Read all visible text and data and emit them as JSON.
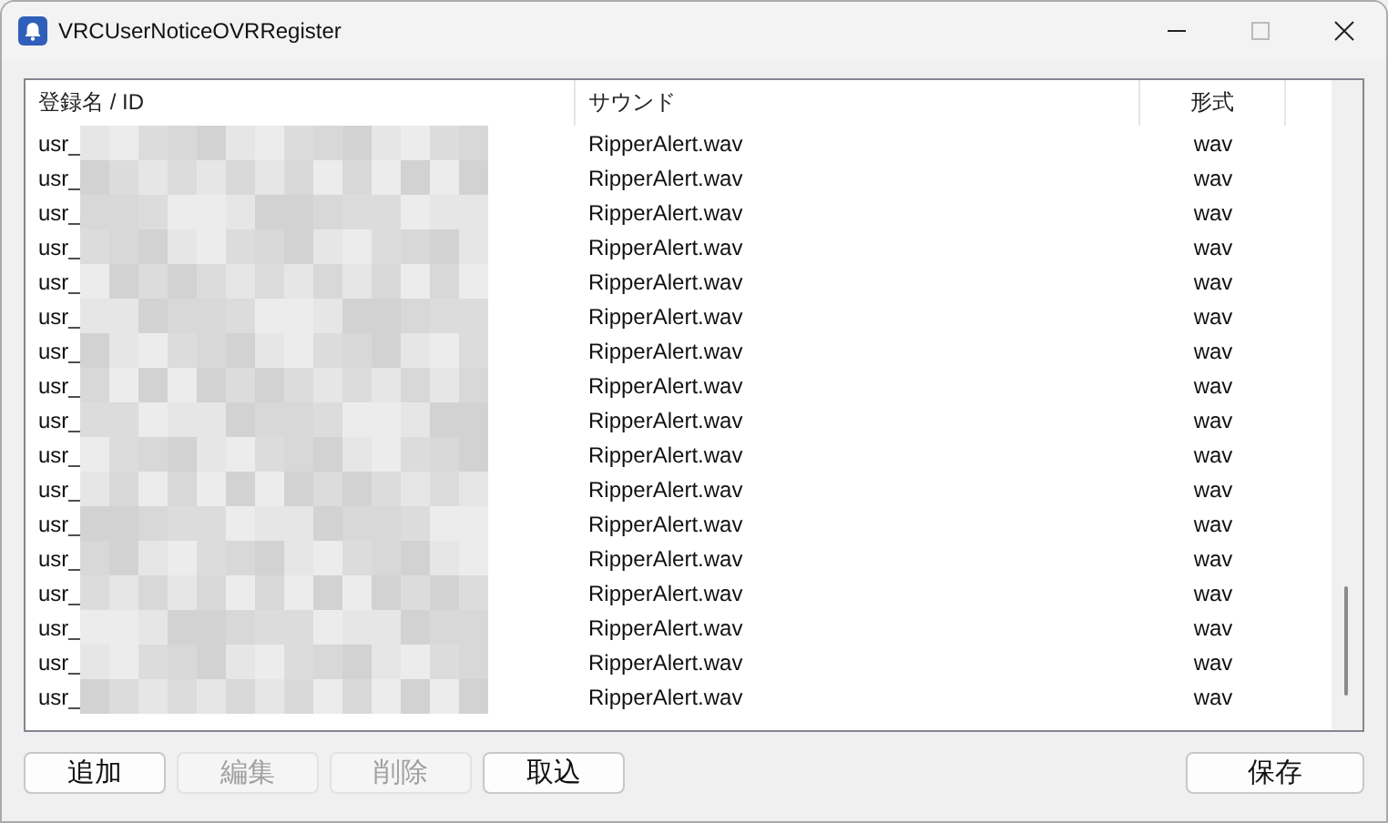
{
  "window": {
    "title": "VRCUserNoticeOVRRegister"
  },
  "table": {
    "columns": [
      "登録名 / ID",
      "サウンド",
      "形式"
    ],
    "rows": [
      {
        "name": "usr_",
        "sound": "RipperAlert.wav",
        "format": "wav"
      },
      {
        "name": "usr_",
        "sound": "RipperAlert.wav",
        "format": "wav"
      },
      {
        "name": "usr_",
        "sound": "RipperAlert.wav",
        "format": "wav"
      },
      {
        "name": "usr_",
        "sound": "RipperAlert.wav",
        "format": "wav"
      },
      {
        "name": "usr_",
        "sound": "RipperAlert.wav",
        "format": "wav"
      },
      {
        "name": "usr_",
        "sound": "RipperAlert.wav",
        "format": "wav"
      },
      {
        "name": "usr_",
        "sound": "RipperAlert.wav",
        "format": "wav"
      },
      {
        "name": "usr_",
        "sound": "RipperAlert.wav",
        "format": "wav"
      },
      {
        "name": "usr_",
        "sound": "RipperAlert.wav",
        "format": "wav"
      },
      {
        "name": "usr_",
        "sound": "RipperAlert.wav",
        "format": "wav"
      },
      {
        "name": "usr_",
        "sound": "RipperAlert.wav",
        "format": "wav"
      },
      {
        "name": "usr_",
        "sound": "RipperAlert.wav",
        "format": "wav"
      },
      {
        "name": "usr_",
        "sound": "RipperAlert.wav",
        "format": "wav"
      },
      {
        "name": "usr_",
        "sound": "RipperAlert.wav",
        "format": "wav"
      },
      {
        "name": "usr_",
        "sound": "RipperAlert.wav",
        "format": "wav"
      },
      {
        "name": "usr_",
        "sound": "RipperAlert.wav",
        "format": "wav"
      },
      {
        "name": "usr_",
        "sound": "RipperAlert.wav",
        "format": "wav"
      }
    ]
  },
  "buttons": [
    {
      "label": "追加",
      "disabled": false
    },
    {
      "label": "編集",
      "disabled": true
    },
    {
      "label": "削除",
      "disabled": true
    },
    {
      "label": "取込",
      "disabled": false
    }
  ],
  "save_button": {
    "label": "保存",
    "disabled": false
  }
}
